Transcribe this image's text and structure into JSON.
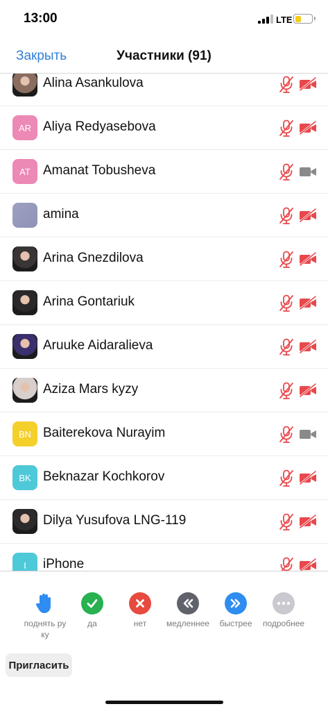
{
  "status_bar": {
    "time": "13:00",
    "network": "LTE",
    "battery_color": "#f5cc19"
  },
  "nav": {
    "close_label": "Закрыть",
    "title": "Участники (91)"
  },
  "participants": [
    {
      "name": "Alina Asankulova",
      "initials": "",
      "avatar_color": "#8a6d5f",
      "avatar_type": "photo",
      "camera_on": false
    },
    {
      "name": "Aliya Redyasebova",
      "initials": "AR",
      "avatar_color": "#ec89b4",
      "avatar_type": "initials",
      "camera_on": false
    },
    {
      "name": "Amanat Tobusheva",
      "initials": "AT",
      "avatar_color": "#ec89b4",
      "avatar_type": "initials",
      "camera_on": true
    },
    {
      "name": "amina",
      "initials": "",
      "avatar_color": "#8f92b5",
      "avatar_type": "blur",
      "camera_on": false
    },
    {
      "name": "Arina Gnezdilova",
      "initials": "",
      "avatar_color": "#3a3535",
      "avatar_type": "photo",
      "camera_on": false
    },
    {
      "name": "Arina Gontariuk",
      "initials": "",
      "avatar_color": "#2a2828",
      "avatar_type": "photo",
      "camera_on": false
    },
    {
      "name": "Aruuke Aidaralieva",
      "initials": "",
      "avatar_color": "#3b2f6e",
      "avatar_type": "photo",
      "camera_on": false
    },
    {
      "name": "Aziza Mars kyzy",
      "initials": "",
      "avatar_color": "#d8cfcc",
      "avatar_type": "photo",
      "camera_on": false
    },
    {
      "name": "Baiterekova Nurayim",
      "initials": "BN",
      "avatar_color": "#f5cf2a",
      "avatar_type": "initials",
      "camera_on": true
    },
    {
      "name": "Beknazar Kochkorov",
      "initials": "BK",
      "avatar_color": "#4ec9d8",
      "avatar_type": "initials",
      "camera_on": false
    },
    {
      "name": "Dilya Yusufova LNG-119",
      "initials": "",
      "avatar_color": "#2c2a2a",
      "avatar_type": "photo",
      "camera_on": false
    },
    {
      "name": "iPhone",
      "initials": "I",
      "avatar_color": "#4ec9d8",
      "avatar_type": "initials",
      "camera_on": false
    }
  ],
  "toolbar": {
    "raise_hand": "поднять руку",
    "yes": "да",
    "no": "нет",
    "slower": "медленнее",
    "faster": "быстрее",
    "more": "подробнее",
    "invite": "Пригласить"
  },
  "colors": {
    "accent": "#2f7fd8",
    "muted_red": "#e8484c",
    "camera_on_gray": "#8a8a8a",
    "yes_green": "#27b150",
    "no_red": "#e74a3f",
    "slow_gray": "#60626b",
    "fast_blue": "#2f8cf0",
    "more_gray": "#c9c9cf"
  }
}
